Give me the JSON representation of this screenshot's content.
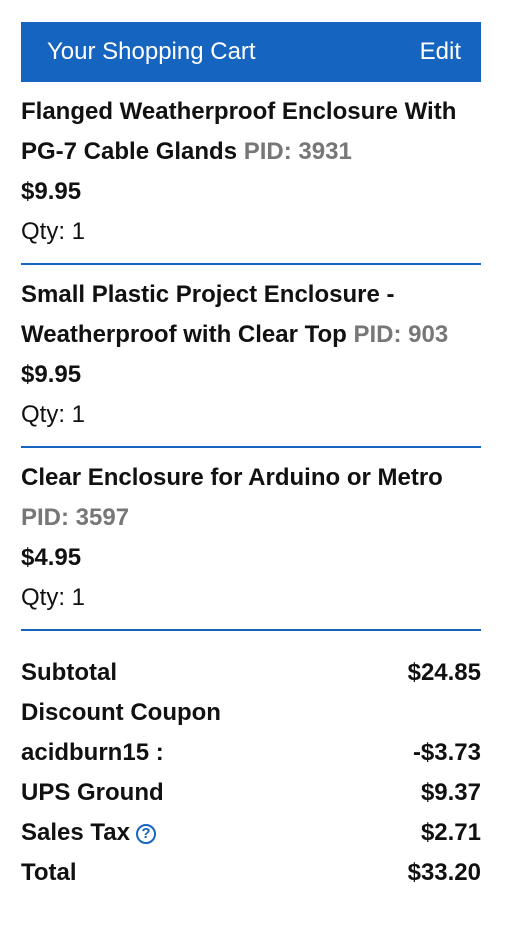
{
  "header": {
    "title": "Your Shopping Cart",
    "edit_label": "Edit"
  },
  "items": [
    {
      "name": "Flanged Weatherproof Enclosure With PG-7 Cable Glands",
      "pid": "PID: 3931",
      "price": "$9.95",
      "qty": "Qty: 1"
    },
    {
      "name": "Small Plastic Project Enclosure - Weatherproof with Clear Top",
      "pid": "PID: 903",
      "price": "$9.95",
      "qty": "Qty: 1"
    },
    {
      "name": "Clear Enclosure for Arduino or Metro",
      "pid": "PID: 3597",
      "price": "$4.95",
      "qty": "Qty: 1"
    }
  ],
  "totals": {
    "subtotal_label": "Subtotal",
    "subtotal_value": "$24.85",
    "discount_label": "Discount Coupon",
    "coupon_code": "acidburn15 :",
    "discount_value": "-$3.73",
    "shipping_label": "UPS Ground",
    "shipping_value": "$9.37",
    "tax_label": "Sales Tax",
    "tax_help_symbol": "?",
    "tax_value": "$2.71",
    "total_label": "Total",
    "total_value": "$33.20"
  },
  "colors": {
    "accent": "#1565c0",
    "pid_gray": "#777777"
  }
}
